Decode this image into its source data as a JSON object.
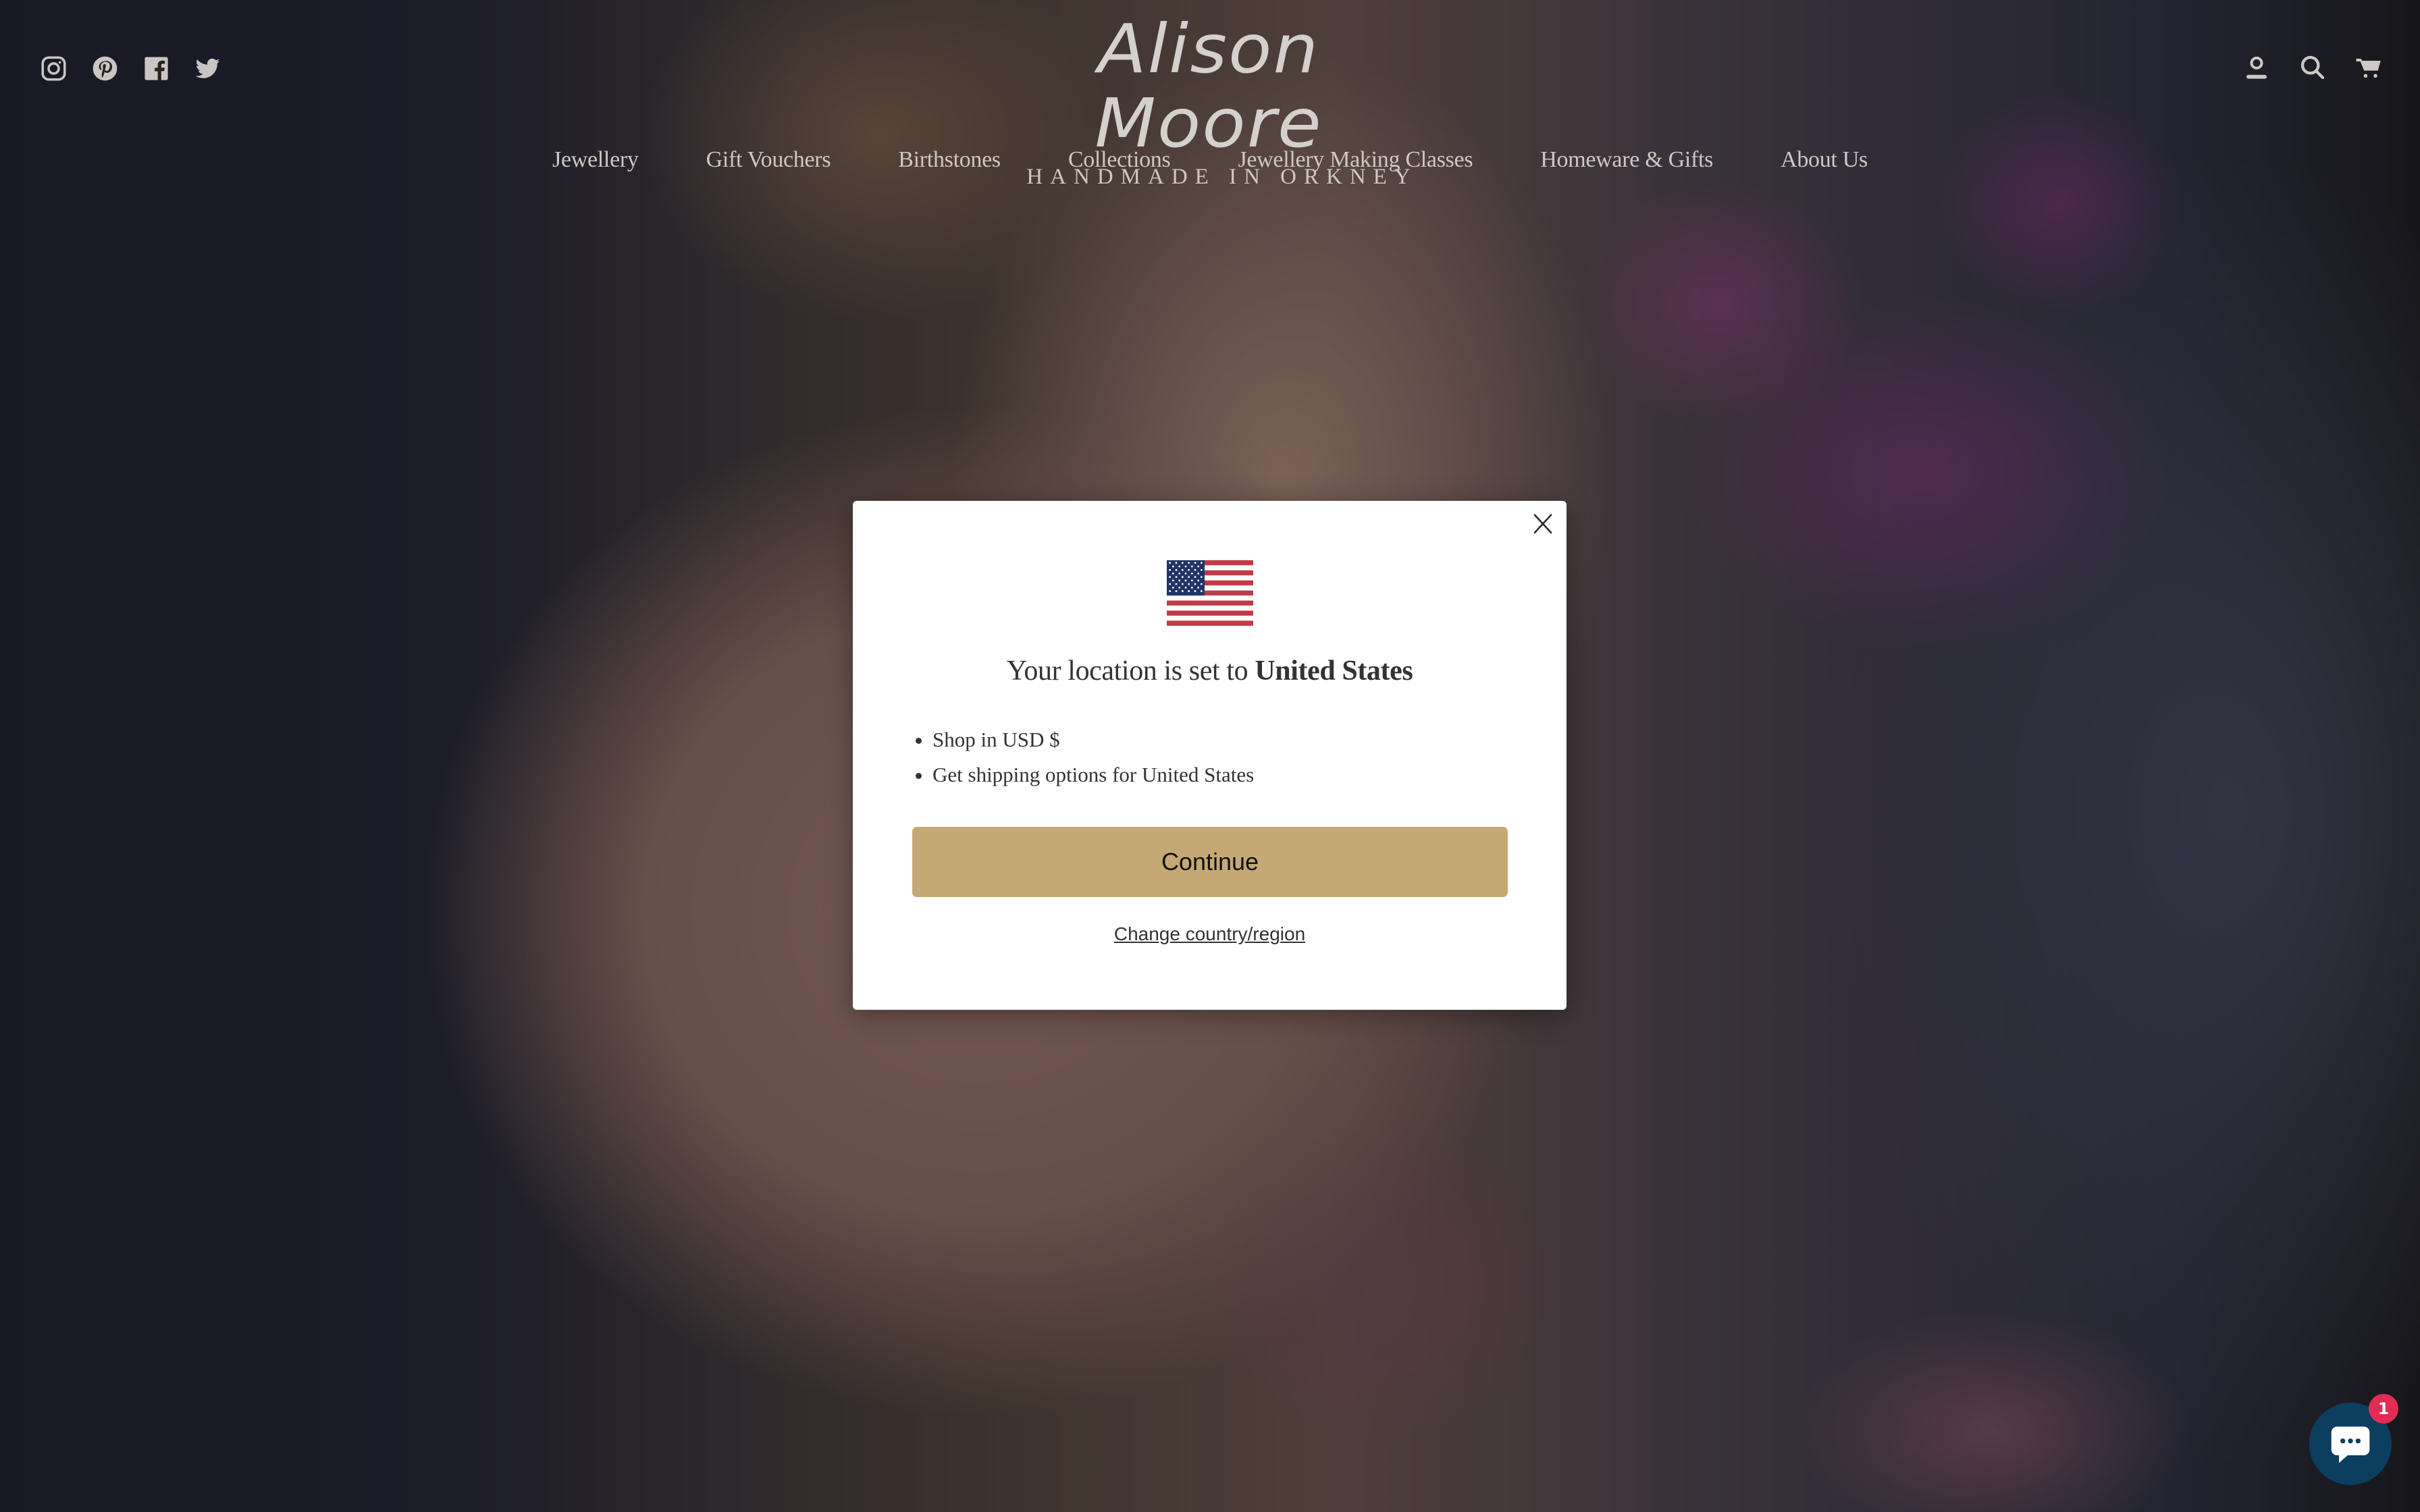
{
  "header": {
    "logo": {
      "name": "Alison Moore",
      "tagline": "HANDMADE IN ORKNEY"
    },
    "social_icons": [
      {
        "icon": "instagram-icon",
        "label": "Instagram"
      },
      {
        "icon": "pinterest-icon",
        "label": "Pinterest"
      },
      {
        "icon": "facebook-icon",
        "label": "Facebook"
      },
      {
        "icon": "twitter-icon",
        "label": "Twitter"
      }
    ],
    "utility_icons": [
      {
        "icon": "account-icon",
        "label": "Account"
      },
      {
        "icon": "search-icon",
        "label": "Search"
      },
      {
        "icon": "cart-icon",
        "label": "Cart"
      }
    ],
    "nav": [
      {
        "label": "Jewellery"
      },
      {
        "label": "Gift Vouchers"
      },
      {
        "label": "Birthstones"
      },
      {
        "label": "Collections"
      },
      {
        "label": "Jewellery Making Classes"
      },
      {
        "label": "Homeware & Gifts"
      },
      {
        "label": "About Us"
      }
    ]
  },
  "modal": {
    "flag": "us-flag-icon",
    "title_prefix": "Your location is set to ",
    "title_country": "United States",
    "bullets": [
      "Shop in USD $",
      "Get shipping options for United States"
    ],
    "continue_label": "Continue",
    "change_link_label": "Change country/region",
    "close_icon": "close-icon"
  },
  "chat_widget": {
    "icon": "chat-bubble-icon",
    "badge_count": "1"
  },
  "colors": {
    "continue_button": "#c4a975",
    "chat_widget": "#0b3e5f",
    "chat_badge": "#e32b56",
    "flag_red": "#bf3b47",
    "flag_blue": "#1f3566"
  }
}
